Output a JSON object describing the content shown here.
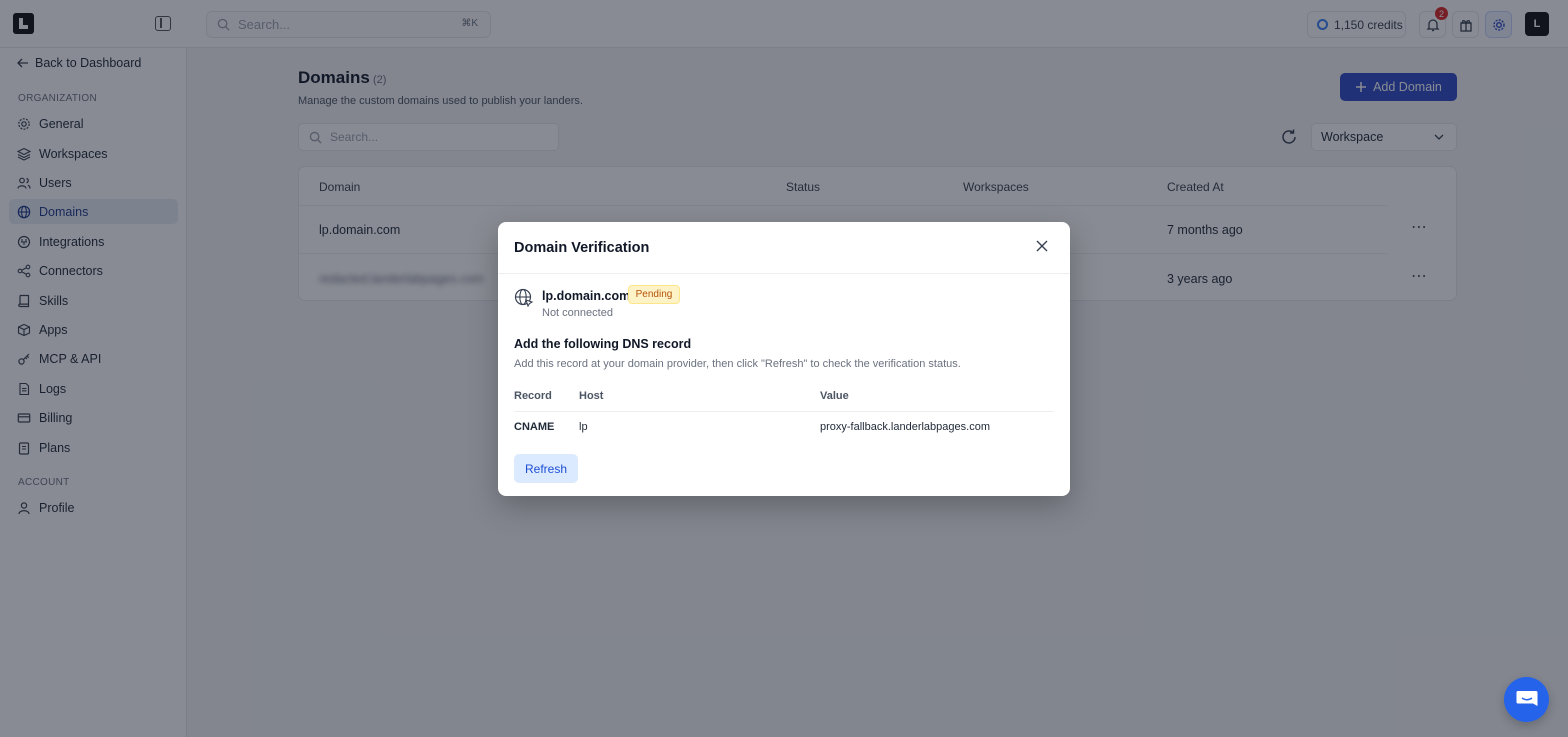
{
  "topbar": {
    "search_placeholder": "Search...",
    "search_shortcut": "⌘K",
    "credits": "1,150 credits",
    "notification_count": "2",
    "avatar_initial": "L"
  },
  "sidebar": {
    "back_label": "Back to Dashboard",
    "org_section": "ORGANIZATION",
    "items": [
      {
        "label": "General",
        "icon": "gear-icon"
      },
      {
        "label": "Workspaces",
        "icon": "layers-icon"
      },
      {
        "label": "Users",
        "icon": "users-icon"
      },
      {
        "label": "Domains",
        "icon": "globe-icon"
      },
      {
        "label": "Integrations",
        "icon": "plug-icon"
      },
      {
        "label": "Connectors",
        "icon": "share-icon"
      },
      {
        "label": "Skills",
        "icon": "book-icon"
      },
      {
        "label": "Apps",
        "icon": "box-icon"
      },
      {
        "label": "MCP & API",
        "icon": "key-icon"
      },
      {
        "label": "Logs",
        "icon": "file-icon"
      },
      {
        "label": "Billing",
        "icon": "card-icon"
      },
      {
        "label": "Plans",
        "icon": "clipboard-icon"
      }
    ],
    "account_section": "ACCOUNT",
    "account_items": [
      {
        "label": "Profile",
        "icon": "user-icon"
      }
    ]
  },
  "main": {
    "title": "Domains",
    "count": "(2)",
    "subtitle": "Manage the custom domains used to publish your landers.",
    "add_button": "Add Domain",
    "search_placeholder": "Search...",
    "workspace_filter": "Workspace",
    "columns": [
      "Domain",
      "Status",
      "Workspaces",
      "Created At"
    ],
    "rows": [
      {
        "domain": "lp.domain.com",
        "created": "7 months ago"
      },
      {
        "domain": "redacted.landerlabpages.com",
        "created": "3 years ago"
      }
    ]
  },
  "modal": {
    "title": "Domain Verification",
    "domain": "lp.domain.com",
    "status": "Pending",
    "connection": "Not connected",
    "dns_title": "Add the following DNS record",
    "dns_subtitle": "Add this record at your domain provider, then click \"Refresh\" to check the verification status.",
    "columns": [
      "Record",
      "Host",
      "Value"
    ],
    "record": {
      "type": "CNAME",
      "host": "lp",
      "value": "proxy-fallback.landerlabpages.com"
    },
    "refresh_button": "Refresh"
  },
  "colors": {
    "accent": "#2e4bc7",
    "pending_bg": "#fef3c7",
    "pending_text": "#b45309",
    "notification": "#dc2626"
  }
}
